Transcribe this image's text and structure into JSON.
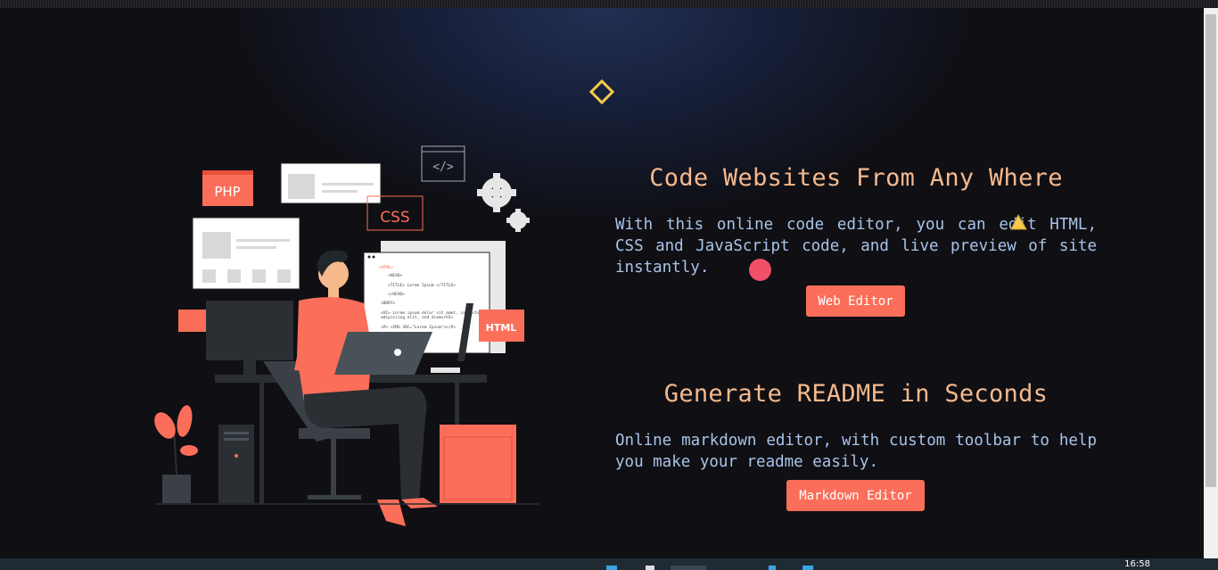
{
  "sections": [
    {
      "title": "Code Websites From Any Where",
      "description": "With this online code editor, you can edit HTML, CSS and JavaScript code, and live preview of site instantly.",
      "button_label": "Web Editor"
    },
    {
      "title": "Generate README in Seconds",
      "description": "Online markdown editor, with custom toolbar to help you make your readme easily.",
      "button_label": "Markdown Editor"
    }
  ],
  "illustration": {
    "tags": {
      "php": "PHP",
      "css": "CSS",
      "html": "HTML",
      "code": "</>"
    },
    "code_lines": [
      "<HTML>",
      "<HEAD>",
      "<TITLE> Lorem Ipsum </TITLE>",
      "</HEAD>",
      "<BODY>",
      "<H1> Lorem ipsum dolor sit amet, consectetur",
      "adipiscing elit, sed diam</H1>",
      "<P> <IMG SRC=\"Lorem Ipsum\"></P>"
    ]
  },
  "taskbar": {
    "clock": "16:58"
  },
  "colors": {
    "accent": "#fb6e5a",
    "heading": "#f5b98c",
    "text": "#a9c4e8",
    "diamond": "#f2c94c",
    "background": "#0f0f14"
  }
}
